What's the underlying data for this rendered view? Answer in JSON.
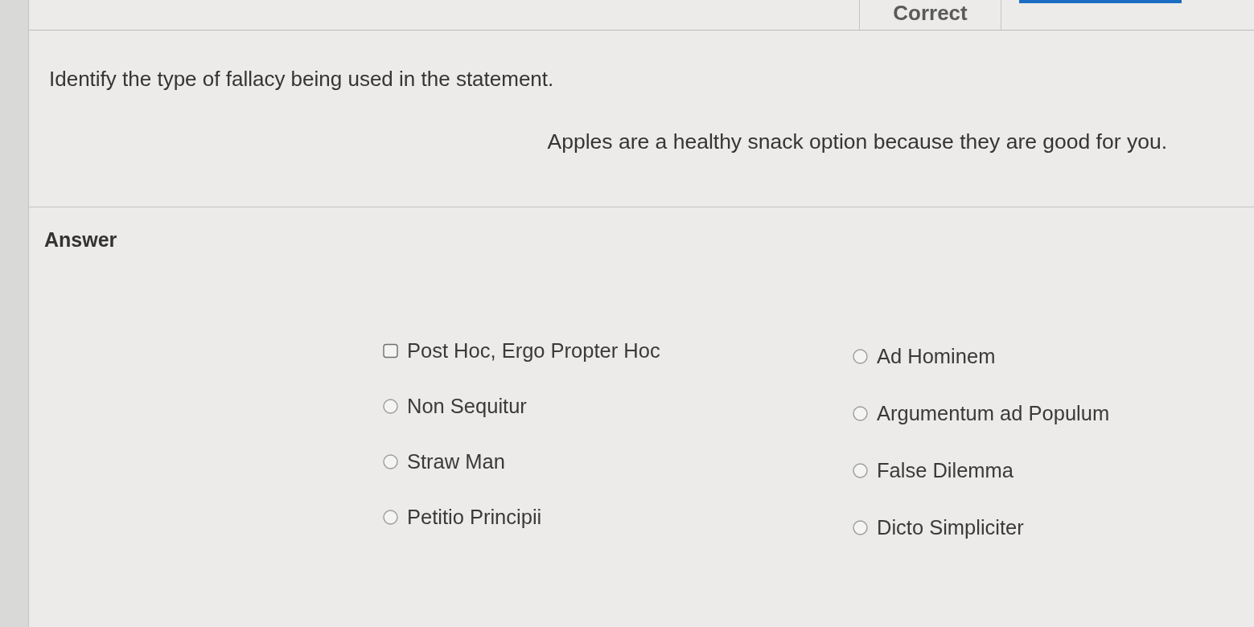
{
  "header": {
    "status": "Correct"
  },
  "question": {
    "prompt": "Identify the type of fallacy being used in the statement.",
    "statement": "Apples are a healthy snack option because they are good for you."
  },
  "answer": {
    "label": "Answer",
    "option_columns": [
      {
        "options": [
          {
            "label": "Post Hoc, Ergo Propter Hoc",
            "selected": false,
            "focused": true
          },
          {
            "label": "Non Sequitur",
            "selected": false,
            "focused": false
          },
          {
            "label": "Straw Man",
            "selected": false,
            "focused": false
          },
          {
            "label": "Petitio Principii",
            "selected": false,
            "focused": false
          }
        ]
      },
      {
        "options": [
          {
            "label": "Ad Hominem",
            "selected": false,
            "focused": false
          },
          {
            "label": "Argumentum ad Populum",
            "selected": false,
            "focused": false
          },
          {
            "label": "False Dilemma",
            "selected": false,
            "focused": false
          },
          {
            "label": "Dicto Simpliciter",
            "selected": false,
            "focused": false
          }
        ]
      }
    ]
  }
}
